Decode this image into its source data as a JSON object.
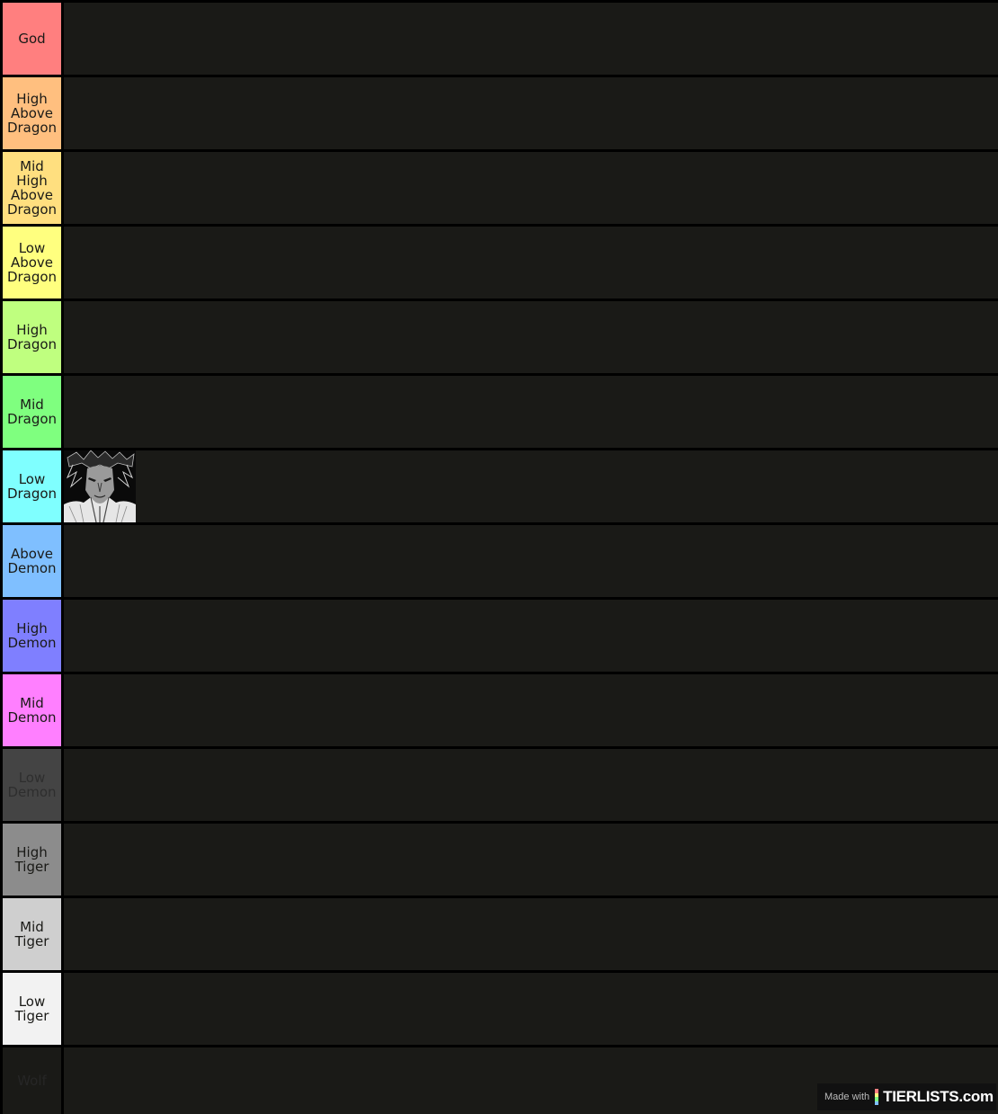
{
  "tiers": [
    {
      "label": "God",
      "color": "#ff7f7f"
    },
    {
      "label": "High\nAbove\nDragon",
      "color": "#ffbf7f"
    },
    {
      "label": "Mid\nHigh\nAbove\nDragon",
      "color": "#ffdf7f"
    },
    {
      "label": "Low\nAbove\nDragon",
      "color": "#ffff7f"
    },
    {
      "label": "High\nDragon",
      "color": "#bfff7f"
    },
    {
      "label": "Mid\nDragon",
      "color": "#7fff7f"
    },
    {
      "label": "Low\nDragon",
      "color": "#7fffff",
      "item": "character-portrait"
    },
    {
      "label": "Above\nDemon",
      "color": "#7fbfff"
    },
    {
      "label": "High\nDemon",
      "color": "#7f7fff"
    },
    {
      "label": "Mid\nDemon",
      "color": "#ff7fff"
    },
    {
      "label": "Low\nDemon",
      "color": "#444444"
    },
    {
      "label": "High\nTiger",
      "color": "#8c8c8c"
    },
    {
      "label": "Mid\nTiger",
      "color": "#cfcfcf"
    },
    {
      "label": "Low\nTiger",
      "color": "#f2f2f2"
    },
    {
      "label": "Wolf",
      "color": "#1a1a17"
    }
  ],
  "watermark": {
    "prefix": "Made with",
    "brand": "TIERLISTS.com"
  }
}
